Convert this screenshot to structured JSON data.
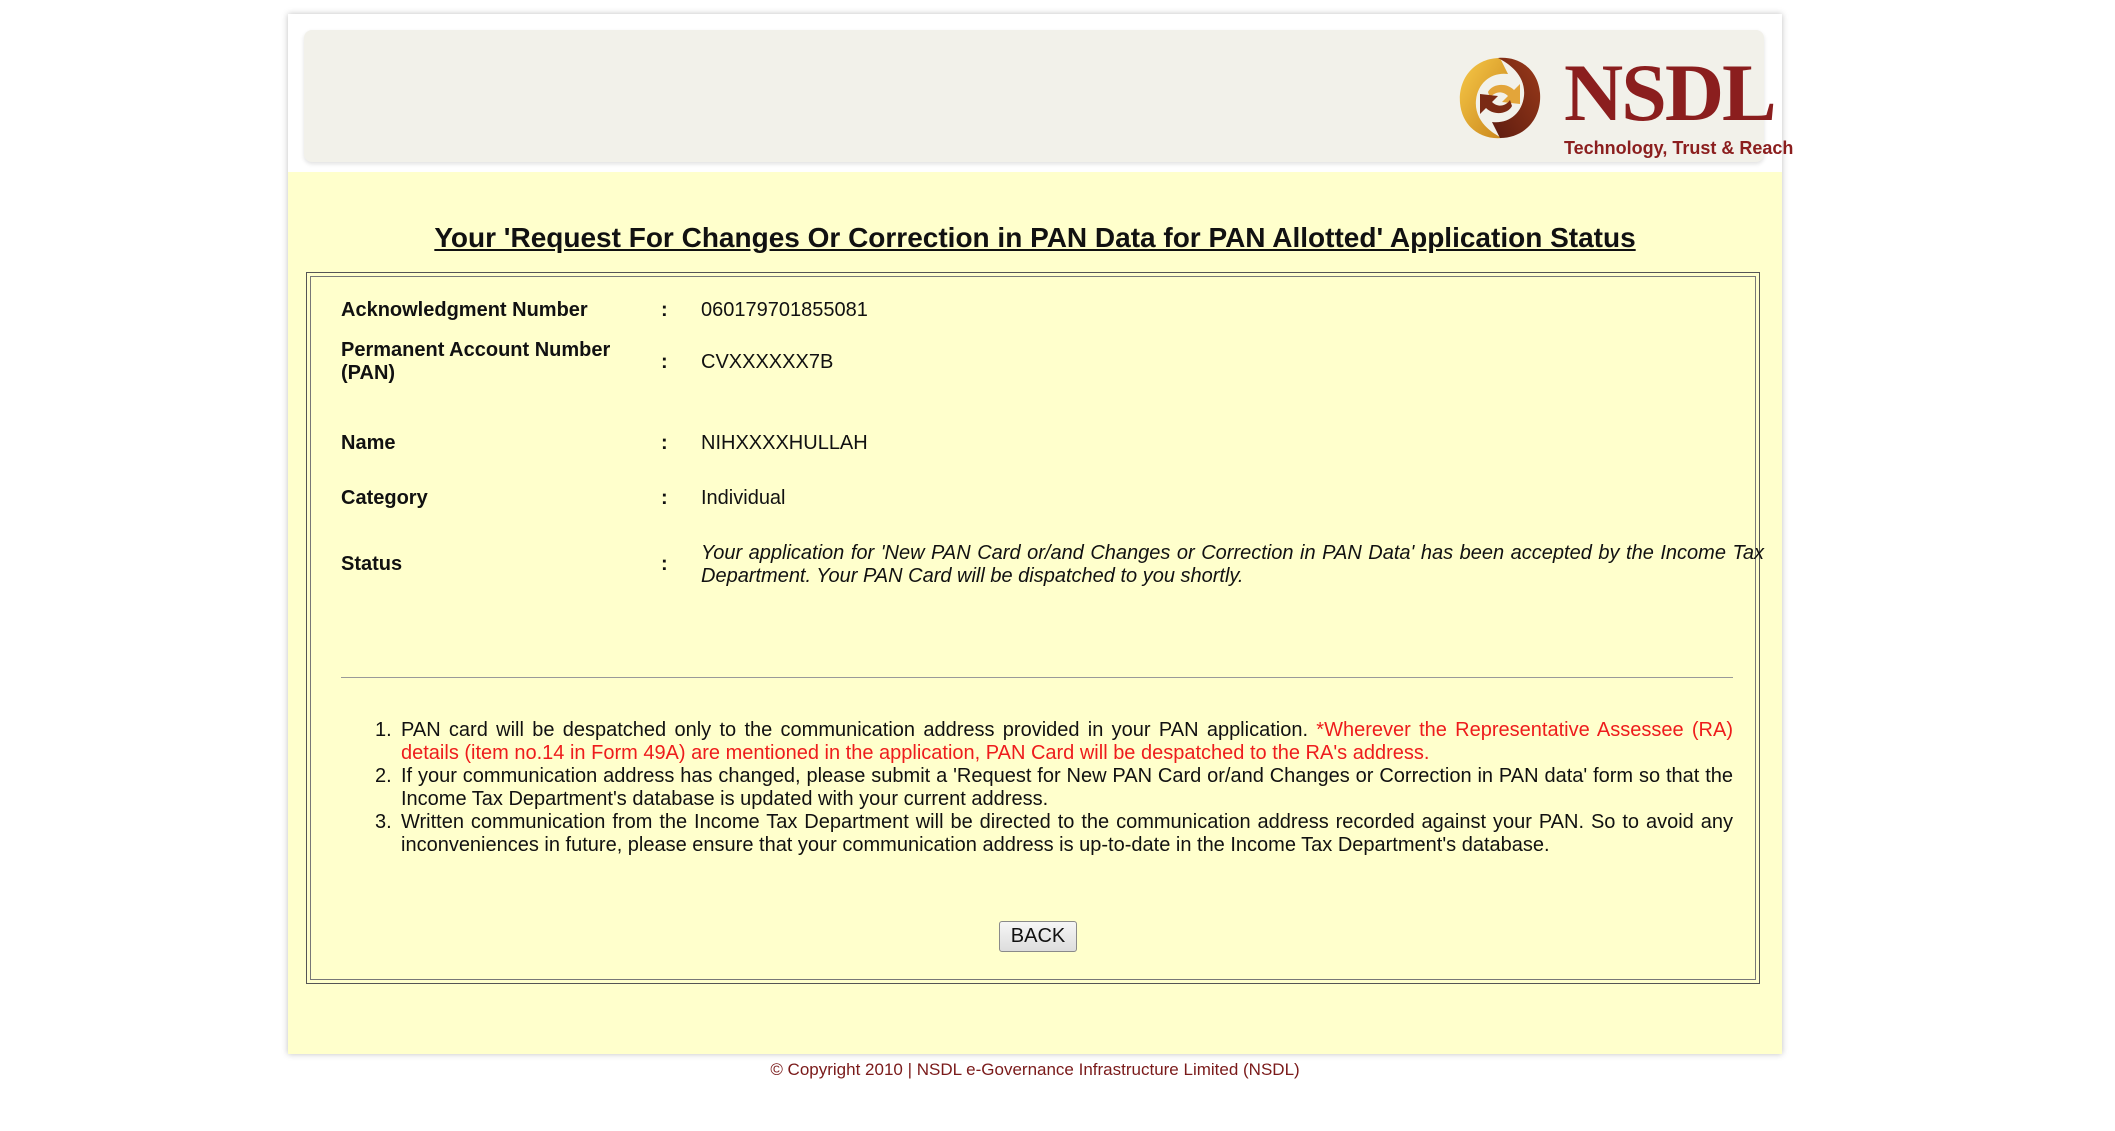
{
  "header": {
    "logo_name": "NSDL",
    "logo_tagline": "Technology, Trust & Reach",
    "logo_icon": "nsdl-swirl-logo"
  },
  "page_title": "Your 'Request For Changes Or Correction in PAN Data for PAN Allotted' Application Status",
  "details": {
    "separator": ":",
    "acknowledgment": {
      "label": "Acknowledgment Number",
      "value": "060179701855081"
    },
    "pan": {
      "label": "Permanent Account Number (PAN)",
      "value": "CVXXXXXX7B"
    },
    "name": {
      "label": "Name",
      "value": "NIHXXXXHULLAH"
    },
    "category": {
      "label": "Category",
      "value": "Individual"
    },
    "status": {
      "label": "Status",
      "value": "Your application for 'New PAN Card or/and Changes or Correction in PAN Data' has been accepted by the Income Tax Department. Your PAN Card will be dispatched to you shortly."
    }
  },
  "notes": [
    {
      "num": "1.",
      "text": "PAN card will be despatched only to the communication address provided in your PAN application. ",
      "highlight": "*Wherever the Representative Assessee (RA) details (item no.14 in Form 49A) are mentioned in the application, PAN Card will be despatched to the RA's address."
    },
    {
      "num": "2.",
      "text": "If your communication address has changed, please submit a 'Request for New PAN Card or/and Changes or Correction in PAN data' form so that the Income Tax Department's database is updated with your current address."
    },
    {
      "num": "3.",
      "text": "Written communication from the Income Tax Department will be directed to the communication address recorded against your PAN. So to avoid any inconveniences in future, please ensure that your communication address is up-to-date in the Income Tax Department's database."
    }
  ],
  "back_button": "BACK",
  "footer": "© Copyright 2010  |  NSDL e-Governance Infrastructure Limited (NSDL)",
  "colors": {
    "page_bg": "#ffffcc",
    "brand": "#8b1e1e",
    "highlight": "#ee1c1c"
  }
}
